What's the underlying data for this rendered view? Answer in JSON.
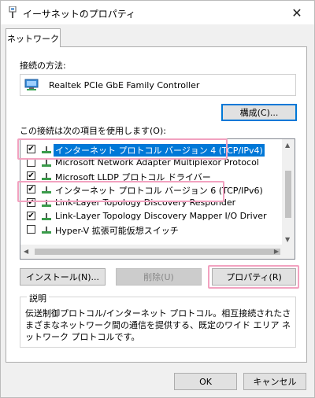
{
  "window": {
    "title": "イーサネットのプロパティ",
    "close_glyph": "✕"
  },
  "tab": {
    "label": "ネットワーク"
  },
  "connect_using": {
    "label": "接続の方法:",
    "adapter": "Realtek PCIe GbE Family Controller",
    "configure_button": "構成(C)..."
  },
  "items_label": "この接続は次の項目を使用します(O):",
  "items": [
    {
      "label": "インターネット プロトコル バージョン 4 (TCP/IPv4)",
      "checked": true,
      "selected": true
    },
    {
      "label": "Microsoft Network Adapter Multiplexor Protocol",
      "checked": false,
      "selected": false
    },
    {
      "label": "Microsoft LLDP プロトコル ドライバー",
      "checked": true,
      "selected": false
    },
    {
      "label": "インターネット プロトコル バージョン 6 (TCP/IPv6)",
      "checked": true,
      "selected": false
    },
    {
      "label": "Link-Layer Topology Discovery Responder",
      "checked": true,
      "selected": false
    },
    {
      "label": "Link-Layer Topology Discovery Mapper I/O Driver",
      "checked": true,
      "selected": false
    },
    {
      "label": "Hyper-V 拡張可能仮想スイッチ",
      "checked": false,
      "selected": false
    }
  ],
  "buttons": {
    "install": "インストール(N)...",
    "uninstall": "削除(U)",
    "properties": "プロパティ(R)"
  },
  "description": {
    "title": "説明",
    "text": "伝送制御プロトコル/インターネット プロトコル。相互接続されたさまざまなネットワーク間の通信を提供する、既定のワイド エリア ネットワーク プロトコルです。"
  },
  "footer": {
    "ok": "OK",
    "cancel": "キャンセル"
  },
  "colors": {
    "selection": "#0078d7",
    "highlight": "#f2a2c0",
    "panel_bg": "#f0f0f0"
  }
}
